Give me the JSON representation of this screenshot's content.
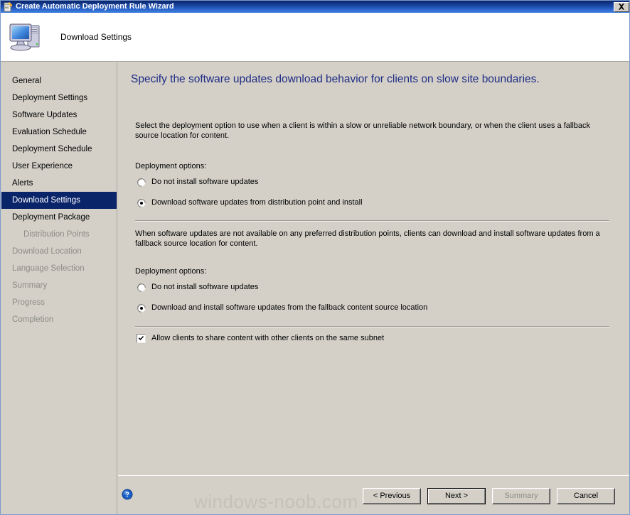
{
  "window": {
    "title": "Create Automatic Deployment Rule Wizard",
    "title_icon": "wizard-document-icon",
    "close_label": "✕"
  },
  "header": {
    "title": "Download Settings",
    "icon": "computer-icon"
  },
  "sidebar": {
    "items": [
      {
        "label": "General",
        "state": "done",
        "indent": false
      },
      {
        "label": "Deployment Settings",
        "state": "done",
        "indent": false
      },
      {
        "label": "Software Updates",
        "state": "done",
        "indent": false
      },
      {
        "label": "Evaluation Schedule",
        "state": "done",
        "indent": false
      },
      {
        "label": "Deployment Schedule",
        "state": "done",
        "indent": false
      },
      {
        "label": "User Experience",
        "state": "done",
        "indent": false
      },
      {
        "label": "Alerts",
        "state": "done",
        "indent": false
      },
      {
        "label": "Download Settings",
        "state": "selected",
        "indent": false
      },
      {
        "label": "Deployment Package",
        "state": "done",
        "indent": false
      },
      {
        "label": "Distribution Points",
        "state": "disabled",
        "indent": true
      },
      {
        "label": "Download Location",
        "state": "disabled",
        "indent": false
      },
      {
        "label": "Language Selection",
        "state": "disabled",
        "indent": false
      },
      {
        "label": "Summary",
        "state": "disabled",
        "indent": false
      },
      {
        "label": "Progress",
        "state": "disabled",
        "indent": false
      },
      {
        "label": "Completion",
        "state": "disabled",
        "indent": false
      }
    ]
  },
  "main": {
    "heading": "Specify the software updates download behavior for clients on slow site boundaries.",
    "heading_color": "#1f2d84",
    "intro": "Select the deployment option to use when a client is within a slow or unreliable network boundary, or when the client uses a fallback source location for content.",
    "section_slow": {
      "label": "Deployment options:",
      "options": [
        {
          "label": "Do not install software updates",
          "selected": false
        },
        {
          "label": "Download software updates from distribution point and install",
          "selected": true
        }
      ]
    },
    "fallback_text": "When software updates are not available on any preferred distribution points, clients can download and install software updates from a fallback source location for content.",
    "section_fallback": {
      "label": "Deployment options:",
      "options": [
        {
          "label": "Do not install software updates",
          "selected": false
        },
        {
          "label": "Download and install software updates from the fallback content source location",
          "selected": true
        }
      ]
    },
    "share_checkbox": {
      "label": "Allow clients to share content with other clients on the same subnet",
      "checked": true
    }
  },
  "footer": {
    "help_icon": "help-question-icon",
    "buttons": [
      {
        "label": "< Previous",
        "state": "enabled",
        "name": "previous-button"
      },
      {
        "label": "Next >",
        "state": "default",
        "name": "next-button"
      },
      {
        "label": "Summary",
        "state": "disabled",
        "name": "summary-button"
      },
      {
        "label": "Cancel",
        "state": "enabled",
        "name": "cancel-button"
      }
    ]
  },
  "watermark": {
    "text": "windows-noob.com"
  }
}
